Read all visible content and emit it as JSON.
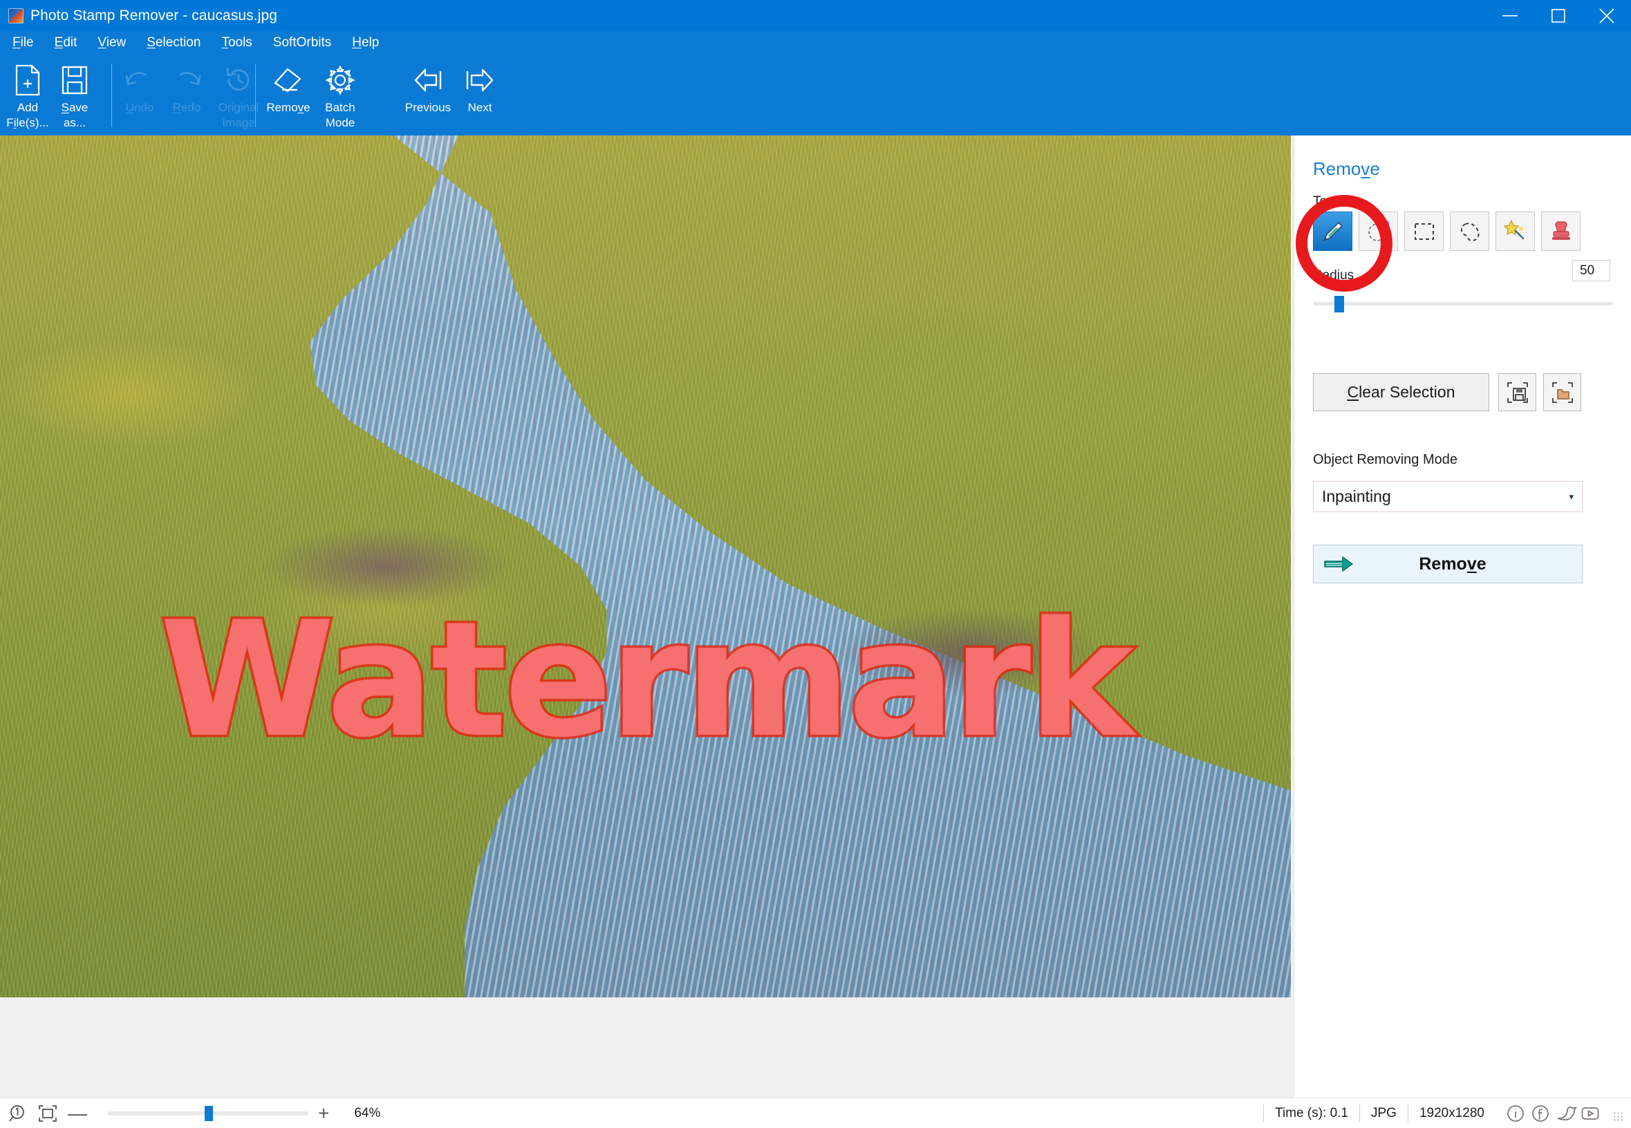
{
  "window": {
    "title": "Photo Stamp Remover - caucasus.jpg",
    "app_icon": "app-photo-icon",
    "minimize": "–",
    "maximize": "▢",
    "close": "✕"
  },
  "menubar": {
    "items": [
      {
        "pre": "",
        "hot": "F",
        "post": "ile"
      },
      {
        "pre": "",
        "hot": "E",
        "post": "dit"
      },
      {
        "pre": "",
        "hot": "V",
        "post": "iew"
      },
      {
        "pre": "",
        "hot": "S",
        "post": "election"
      },
      {
        "pre": "",
        "hot": "T",
        "post": "ools"
      },
      {
        "pre": "SoftOrbits",
        "hot": "",
        "post": ""
      },
      {
        "pre": "",
        "hot": "H",
        "post": "elp"
      }
    ]
  },
  "ribbon": {
    "buttons": [
      {
        "id": "add-files",
        "line1": "Add",
        "line2_pre": "F",
        "line2_hot": "i",
        "line2_post": "le(s)...",
        "icon": "document-plus-icon",
        "enabled": true
      },
      {
        "id": "save-as",
        "line1_pre": "",
        "line1_hot": "S",
        "line1_post": "ave",
        "line2": "as...",
        "icon": "floppy-disk-icon",
        "enabled": true
      },
      {
        "id": "undo",
        "line1_pre": "",
        "line1_hot": "U",
        "line1_post": "ndo",
        "line2": "",
        "icon": "undo-arrow-icon",
        "enabled": false
      },
      {
        "id": "redo",
        "line1_pre": "",
        "line1_hot": "R",
        "line1_post": "edo",
        "line2": "",
        "icon": "redo-arrow-icon",
        "enabled": false
      },
      {
        "id": "original-image",
        "line1": "Original",
        "line2": "Image",
        "icon": "clock-history-icon",
        "enabled": false
      },
      {
        "id": "remove",
        "line1_pre": "Remo",
        "line1_hot": "v",
        "line1_post": "e",
        "line2": "",
        "icon": "eraser-icon",
        "enabled": true
      },
      {
        "id": "batch-mode",
        "line1": "Batch",
        "line2": "Mode",
        "icon": "gear-icon",
        "enabled": true
      },
      {
        "id": "previous",
        "line1": "Previous",
        "line2": "",
        "icon": "arrow-left-icon",
        "enabled": true
      },
      {
        "id": "next",
        "line1": "Next",
        "line2": "",
        "icon": "arrow-right-icon",
        "enabled": true
      }
    ]
  },
  "canvas": {
    "watermark_text": "Watermark",
    "watermark_color": "#f5706e",
    "watermark_outline_color": "#e42812",
    "image_name": "caucasus.jpg"
  },
  "panel": {
    "title_pre": "Remo",
    "title_hot": "v",
    "title_post": "e",
    "tools_label": "Tools",
    "tools": [
      {
        "id": "marker-tool",
        "icon": "marker-pen-icon",
        "selected": true
      },
      {
        "id": "highlighter-tool",
        "icon": "highlighter-icon",
        "selected": false
      },
      {
        "id": "rectangle-tool",
        "icon": "dashed-rectangle-icon",
        "selected": false
      },
      {
        "id": "lasso-tool",
        "icon": "lasso-icon",
        "selected": false
      },
      {
        "id": "magic-wand-tool",
        "icon": "magic-wand-icon",
        "selected": false
      },
      {
        "id": "stamp-tool",
        "icon": "rubber-stamp-icon",
        "selected": false
      }
    ],
    "radius_label": "Radius",
    "radius_value": "50",
    "radius_slider_percent": 7,
    "clear_selection_pre": "",
    "clear_selection_hot": "C",
    "clear_selection_post": "lear Selection",
    "save_selection_icon": "save-selection-icon",
    "load_selection_icon": "load-selection-icon",
    "mode_label": "Object Removing Mode",
    "mode_value": "Inpainting",
    "mode_caret": "▾",
    "remove_pre": "Remo",
    "remove_hot": "v",
    "remove_post": "e",
    "remove_arrow_icon": "green-arrow-right-icon",
    "accent_blue": "#0a7bd4",
    "panel_title_color": "#1a7ed6"
  },
  "statusbar": {
    "zoom_1to1_icon": "zoom-actual-size-icon",
    "fit_screen_icon": "fit-to-window-icon",
    "minus": "—",
    "plus": "+",
    "zoom_percent": "64%",
    "zoom_slider_percent": 48,
    "time_label": "Time (s): 0.1",
    "format_label": "JPG",
    "dimensions_label": "1920x1280",
    "social": [
      {
        "id": "info-icon",
        "glyph": "i"
      },
      {
        "id": "facebook-icon",
        "glyph": "f"
      },
      {
        "id": "twitter-icon",
        "glyph": "t"
      },
      {
        "id": "youtube-icon",
        "glyph": "▶"
      }
    ],
    "resize_grip_icon": "resize-grip-icon"
  },
  "annotation": {
    "circle_color": "#e8191c",
    "target": "marker-tool"
  }
}
